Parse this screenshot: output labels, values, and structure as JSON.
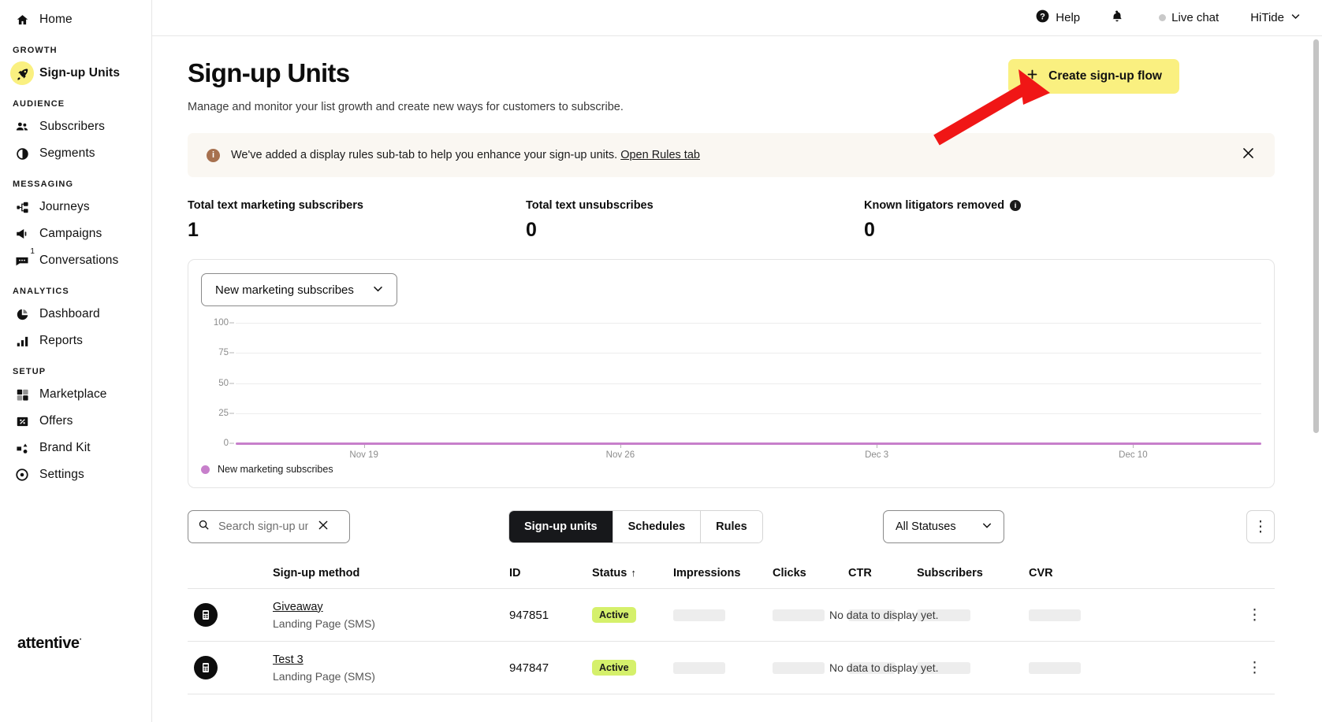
{
  "sidebar": {
    "home": {
      "label": "Home",
      "icon": "home-icon"
    },
    "sections": [
      {
        "title": "GROWTH",
        "items": [
          {
            "label": "Sign-up Units",
            "icon": "rocket-icon",
            "active": true
          }
        ]
      },
      {
        "title": "AUDIENCE",
        "items": [
          {
            "label": "Subscribers",
            "icon": "people-icon",
            "active": false
          },
          {
            "label": "Segments",
            "icon": "segments-icon",
            "active": false
          }
        ]
      },
      {
        "title": "MESSAGING",
        "items": [
          {
            "label": "Journeys",
            "icon": "journeys-icon",
            "active": false
          },
          {
            "label": "Campaigns",
            "icon": "megaphone-icon",
            "active": false
          },
          {
            "label": "Conversations",
            "icon": "chat-icon",
            "active": false,
            "badge": "1"
          }
        ]
      },
      {
        "title": "ANALYTICS",
        "items": [
          {
            "label": "Dashboard",
            "icon": "pie-chart-icon",
            "active": false
          },
          {
            "label": "Reports",
            "icon": "bar-chart-icon",
            "active": false
          }
        ]
      },
      {
        "title": "SETUP",
        "items": [
          {
            "label": "Marketplace",
            "icon": "marketplace-icon",
            "active": false
          },
          {
            "label": "Offers",
            "icon": "ticket-icon",
            "active": false
          },
          {
            "label": "Brand Kit",
            "icon": "brand-kit-icon",
            "active": false
          },
          {
            "label": "Settings",
            "icon": "gear-icon",
            "active": false
          }
        ]
      }
    ],
    "brand": "attentive",
    "brand_mark": "·"
  },
  "topbar": {
    "help": "Help",
    "live_chat": "Live chat",
    "account": "HiTide"
  },
  "header": {
    "title": "Sign-up Units",
    "subtitle": "Manage and monitor your list growth and create new ways for customers to subscribe.",
    "create_button": "Create sign-up flow",
    "create_button_color": "#FAF080"
  },
  "banner": {
    "icon": "info-icon",
    "text": "We've added a display rules sub-tab to help you enhance your sign-up units.",
    "link": "Open Rules tab",
    "close": "✕",
    "bg": "#FAF7F2"
  },
  "stats": [
    {
      "label": "Total text marketing subscribers",
      "value": "1",
      "info": false
    },
    {
      "label": "Total text unsubscribes",
      "value": "0",
      "info": false
    },
    {
      "label": "Known litigators removed",
      "value": "0",
      "info": true
    }
  ],
  "chart_card": {
    "metric_selected": "New marketing subscribes"
  },
  "chart_data": {
    "type": "line",
    "title": "New marketing subscribes",
    "xlabel": "",
    "ylabel": "",
    "x": [
      "Nov 19",
      "Nov 26",
      "Dec 3",
      "Dec 10"
    ],
    "series": [
      {
        "name": "New marketing subscribes",
        "color": "#C77FCB",
        "values": [
          0,
          0,
          0,
          0
        ]
      }
    ],
    "ylim": [
      0,
      100
    ],
    "yticks": [
      0,
      25,
      50,
      75,
      100
    ],
    "grid": true,
    "legend_position": "bottom-left"
  },
  "controls": {
    "search_placeholder": "Search sign-up units",
    "search_value": "",
    "clear_icon": "✕",
    "tabs": [
      {
        "label": "Sign-up units",
        "selected": true
      },
      {
        "label": "Schedules",
        "selected": false
      },
      {
        "label": "Rules",
        "selected": false
      }
    ],
    "status_filter": "All Statuses",
    "kebab": "⋮"
  },
  "table": {
    "columns": [
      "Sign-up method",
      "ID",
      "Status",
      "Impressions",
      "Clicks",
      "CTR",
      "Subscribers",
      "CVR"
    ],
    "sorted_column": "Status",
    "sort_arrow": "↑",
    "no_data_text": "No data to display yet.",
    "rows": [
      {
        "icon": "signup-unit-icon",
        "name": "Giveaway",
        "type": "Landing Page (SMS)",
        "id": "947851",
        "status": "Active",
        "status_color": "#D5F06B",
        "impressions": "",
        "clicks": "",
        "ctr": "",
        "subscribers": "",
        "cvr": "",
        "kebab": "⋮"
      },
      {
        "icon": "signup-unit-icon",
        "name": "Test 3",
        "type": "Landing Page (SMS)",
        "id": "947847",
        "status": "Active",
        "status_color": "#D5F06B",
        "impressions": "",
        "clicks": "",
        "ctr": "",
        "subscribers": "",
        "cvr": "",
        "kebab": "⋮"
      }
    ]
  },
  "annotation": {
    "arrow_color": "#F01616",
    "points_to": "create-sign-up-flow-button"
  }
}
